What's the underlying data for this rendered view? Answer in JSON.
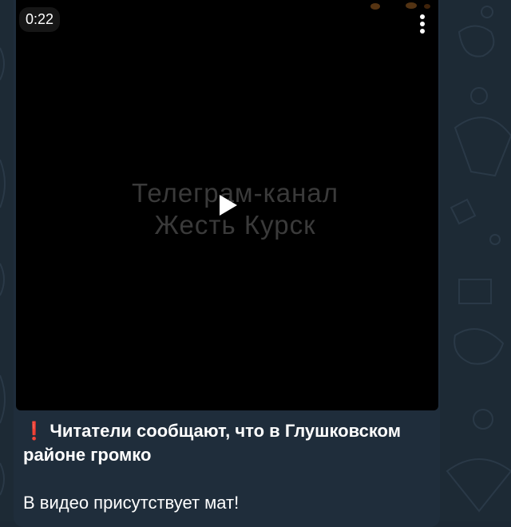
{
  "video": {
    "duration": "0:22",
    "watermark_line1": "Телеграм-канал",
    "watermark_line2": "Жесть Курск"
  },
  "message": {
    "alert_icon": "❗",
    "headline": "Читатели сообщают, что в Глушковском районе громко",
    "note": "В видео присутствует мат!"
  },
  "icons": {
    "menu": "more-vertical-icon",
    "play": "play-icon",
    "alert": "exclamation-icon"
  },
  "colors": {
    "chat_background": "#1d2a35",
    "bubble": "#1f2d3b",
    "alert": "#e0272c"
  }
}
